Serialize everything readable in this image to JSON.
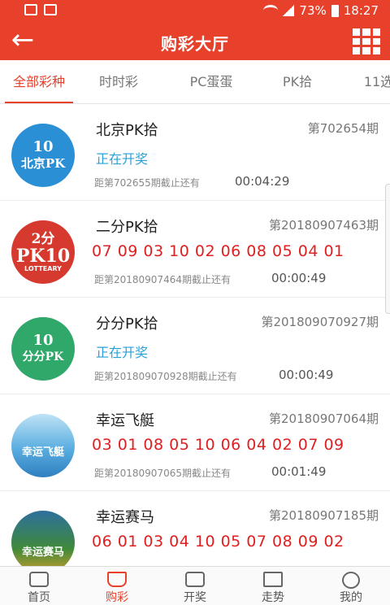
{
  "status_bar": {
    "battery": "73%",
    "time": "18:27"
  },
  "header": {
    "title": "购彩大厅"
  },
  "tabs": [
    {
      "label": "全部彩种",
      "active": true
    },
    {
      "label": "时时彩",
      "active": false
    },
    {
      "label": "PC蛋蛋",
      "active": false
    },
    {
      "label": "PK拾",
      "active": false
    },
    {
      "label": "11选",
      "active": false
    }
  ],
  "lotteries": [
    {
      "name": "北京PK拾",
      "period": "第702654期",
      "status": "正在开奖",
      "numbers": "",
      "deadline": "距第702655期截止还有",
      "countdown": "00:04:29",
      "logo": {
        "line1": "10",
        "line2": "北京PK",
        "color": "#2b8fd6"
      }
    },
    {
      "name": "二分PK拾",
      "period": "第20180907463期",
      "status": "",
      "numbers": "07 09 03 10 02 06 08 05 04 01",
      "deadline": "距第20180907464期截止还有",
      "countdown": "00:00:49",
      "logo": {
        "line1": "2分",
        "line2": "PK10",
        "line3": "LOTTEARY",
        "color": "#d63a2e"
      }
    },
    {
      "name": "分分PK拾",
      "period": "第201809070927期",
      "status": "正在开奖",
      "numbers": "",
      "deadline": "距第201809070928期截止还有",
      "countdown": "00:00:49",
      "logo": {
        "line1": "10",
        "line2": "分分PK",
        "color": "#2fa86a"
      }
    },
    {
      "name": "幸运飞艇",
      "period": "第20180907064期",
      "status": "",
      "numbers": "03 01 08 05 10 06 04 02 07 09",
      "deadline": "距第20180907065期截止还有",
      "countdown": "00:01:49",
      "logo": {
        "line1": "幸运飞艇",
        "line2": "",
        "color": "#3a9ad8"
      }
    },
    {
      "name": "幸运赛马",
      "period": "第20180907185期",
      "status": "",
      "numbers": "06 01 03 04 10 05 07 08 09 02",
      "deadline": "",
      "countdown": "",
      "logo": {
        "line1": "幸运赛马",
        "line2": "",
        "color": "#3f8a3a"
      }
    }
  ],
  "bottom_nav": [
    {
      "label": "首页",
      "icon": "home-icon",
      "active": false
    },
    {
      "label": "购彩",
      "icon": "cart-icon",
      "active": true
    },
    {
      "label": "开奖",
      "icon": "award-icon",
      "active": false
    },
    {
      "label": "走势",
      "icon": "trend-icon",
      "active": false
    },
    {
      "label": "我的",
      "icon": "user-icon",
      "active": false
    }
  ],
  "colors": {
    "accent": "#e8412b",
    "open_status": "#2aa0d8",
    "numbers": "#e02020"
  }
}
